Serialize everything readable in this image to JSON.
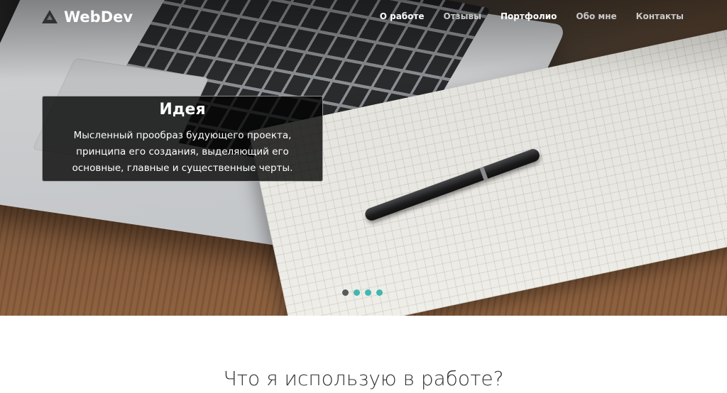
{
  "navbar": {
    "brand": "WebDev",
    "links": [
      {
        "label": "О работе",
        "active": true
      },
      {
        "label": "Отзывы",
        "active": false
      },
      {
        "label": "Портфолио",
        "active": true
      },
      {
        "label": "Обо мне",
        "active": false
      },
      {
        "label": "Контакты",
        "active": false
      }
    ]
  },
  "carousel": {
    "slide_title": "Идея",
    "slide_text": "Мысленный прообраз будующего проекта, принципа его создания, выделяющий его основные, главные и существенные черты.",
    "indicator_count": 4,
    "active_index": 0,
    "colors": {
      "indicator": "#40b8b0",
      "indicator_active": "#555a5c"
    }
  },
  "section": {
    "title": "Что я использую в работе?"
  }
}
